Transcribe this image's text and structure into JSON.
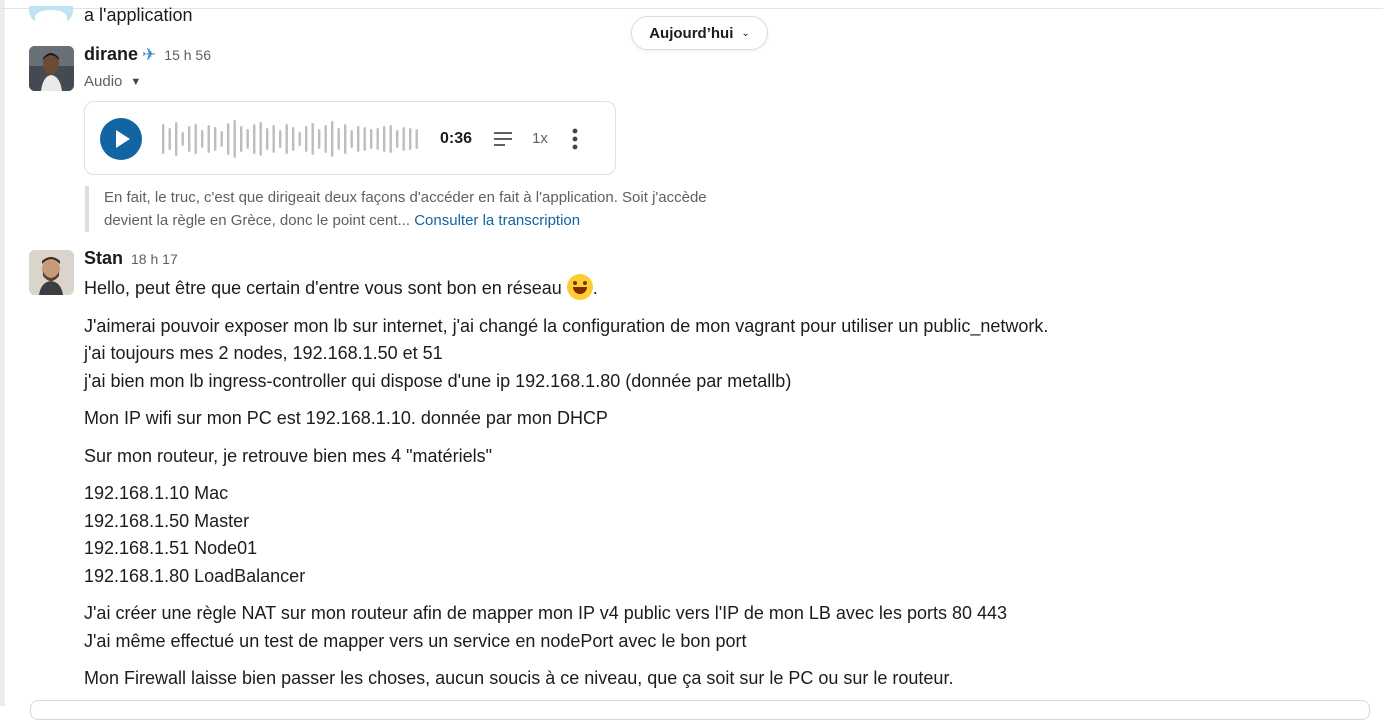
{
  "previous_message": {
    "text_tail": "a l'application"
  },
  "date_divider": {
    "label": "Aujourd’hui",
    "icon": "chevron-down-icon"
  },
  "messages": [
    {
      "author": "dirane",
      "status_emoji": "✈️",
      "time": "15 h 56",
      "attachment_label": "Audio",
      "audio": {
        "duration": "0:36",
        "speed": "1x",
        "play_icon": "play-icon",
        "transcript_icon": "transcript-icon",
        "more_icon": "more-vertical-icon"
      },
      "transcript_excerpt": "En fait, le truc, c'est que dirigeait deux façons d'accéder en fait à l'application. Soit j'accède devient la règle en Grèce, donc le point cent...",
      "transcript_link": "Consulter la transcription"
    },
    {
      "author": "Stan",
      "time": "18 h 17",
      "paragraphs": [
        [
          "Hello, peut être que certain d'entre vous sont bon en réseau",
          "."
        ],
        [
          "J'aimerai pouvoir exposer mon lb sur internet, j'ai changé la configuration de mon vagrant pour utiliser un public_network.",
          "j'ai toujours mes 2 nodes, 192.168.1.50 et 51",
          "j'ai bien mon lb ingress-controller qui dispose d'une ip 192.168.1.80 (donnée par metallb)"
        ],
        [
          "Mon IP wifi sur mon PC est 192.168.1.10. donnée par mon DHCP"
        ],
        [
          "Sur mon routeur, je retrouve bien mes 4 \"matériels\""
        ],
        [
          "192.168.1.10 Mac",
          "192.168.1.50 Master",
          "192.168.1.51 Node01",
          "192.168.1.80 LoadBalancer"
        ],
        [
          "J'ai créer une règle NAT sur mon routeur afin de mapper mon IP v4 public vers l'IP de mon LB avec les ports 80 443",
          "J'ai même effectué un test de mapper vers un service en nodePort avec le bon port"
        ],
        [
          "Mon Firewall laisse bien passer les choses, aucun soucis à ce niveau, que ça soit sur le PC ou sur le routeur."
        ]
      ]
    }
  ],
  "colors": {
    "accent": "#1264a3",
    "text": "#1d1c1d",
    "muted": "#616061"
  }
}
